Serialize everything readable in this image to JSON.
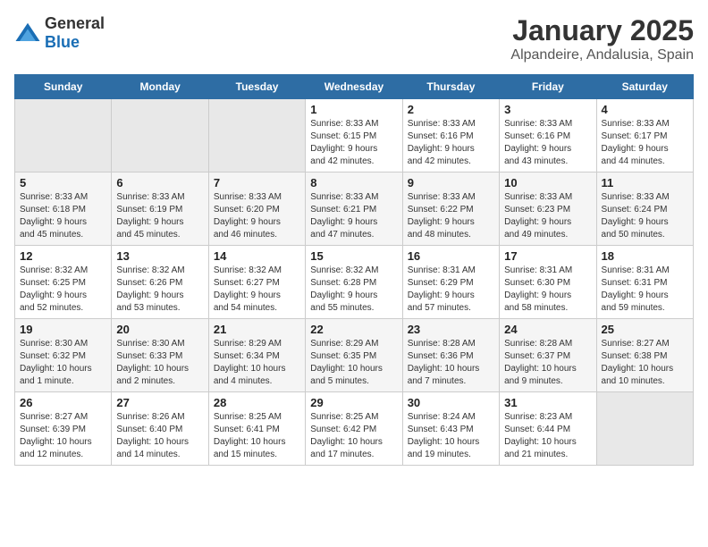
{
  "header": {
    "logo_general": "General",
    "logo_blue": "Blue",
    "title": "January 2025",
    "subtitle": "Alpandeire, Andalusia, Spain"
  },
  "weekdays": [
    "Sunday",
    "Monday",
    "Tuesday",
    "Wednesday",
    "Thursday",
    "Friday",
    "Saturday"
  ],
  "weeks": [
    [
      {
        "day": "",
        "info": ""
      },
      {
        "day": "",
        "info": ""
      },
      {
        "day": "",
        "info": ""
      },
      {
        "day": "1",
        "info": "Sunrise: 8:33 AM\nSunset: 6:15 PM\nDaylight: 9 hours\nand 42 minutes."
      },
      {
        "day": "2",
        "info": "Sunrise: 8:33 AM\nSunset: 6:16 PM\nDaylight: 9 hours\nand 42 minutes."
      },
      {
        "day": "3",
        "info": "Sunrise: 8:33 AM\nSunset: 6:16 PM\nDaylight: 9 hours\nand 43 minutes."
      },
      {
        "day": "4",
        "info": "Sunrise: 8:33 AM\nSunset: 6:17 PM\nDaylight: 9 hours\nand 44 minutes."
      }
    ],
    [
      {
        "day": "5",
        "info": "Sunrise: 8:33 AM\nSunset: 6:18 PM\nDaylight: 9 hours\nand 45 minutes."
      },
      {
        "day": "6",
        "info": "Sunrise: 8:33 AM\nSunset: 6:19 PM\nDaylight: 9 hours\nand 45 minutes."
      },
      {
        "day": "7",
        "info": "Sunrise: 8:33 AM\nSunset: 6:20 PM\nDaylight: 9 hours\nand 46 minutes."
      },
      {
        "day": "8",
        "info": "Sunrise: 8:33 AM\nSunset: 6:21 PM\nDaylight: 9 hours\nand 47 minutes."
      },
      {
        "day": "9",
        "info": "Sunrise: 8:33 AM\nSunset: 6:22 PM\nDaylight: 9 hours\nand 48 minutes."
      },
      {
        "day": "10",
        "info": "Sunrise: 8:33 AM\nSunset: 6:23 PM\nDaylight: 9 hours\nand 49 minutes."
      },
      {
        "day": "11",
        "info": "Sunrise: 8:33 AM\nSunset: 6:24 PM\nDaylight: 9 hours\nand 50 minutes."
      }
    ],
    [
      {
        "day": "12",
        "info": "Sunrise: 8:32 AM\nSunset: 6:25 PM\nDaylight: 9 hours\nand 52 minutes."
      },
      {
        "day": "13",
        "info": "Sunrise: 8:32 AM\nSunset: 6:26 PM\nDaylight: 9 hours\nand 53 minutes."
      },
      {
        "day": "14",
        "info": "Sunrise: 8:32 AM\nSunset: 6:27 PM\nDaylight: 9 hours\nand 54 minutes."
      },
      {
        "day": "15",
        "info": "Sunrise: 8:32 AM\nSunset: 6:28 PM\nDaylight: 9 hours\nand 55 minutes."
      },
      {
        "day": "16",
        "info": "Sunrise: 8:31 AM\nSunset: 6:29 PM\nDaylight: 9 hours\nand 57 minutes."
      },
      {
        "day": "17",
        "info": "Sunrise: 8:31 AM\nSunset: 6:30 PM\nDaylight: 9 hours\nand 58 minutes."
      },
      {
        "day": "18",
        "info": "Sunrise: 8:31 AM\nSunset: 6:31 PM\nDaylight: 9 hours\nand 59 minutes."
      }
    ],
    [
      {
        "day": "19",
        "info": "Sunrise: 8:30 AM\nSunset: 6:32 PM\nDaylight: 10 hours\nand 1 minute."
      },
      {
        "day": "20",
        "info": "Sunrise: 8:30 AM\nSunset: 6:33 PM\nDaylight: 10 hours\nand 2 minutes."
      },
      {
        "day": "21",
        "info": "Sunrise: 8:29 AM\nSunset: 6:34 PM\nDaylight: 10 hours\nand 4 minutes."
      },
      {
        "day": "22",
        "info": "Sunrise: 8:29 AM\nSunset: 6:35 PM\nDaylight: 10 hours\nand 5 minutes."
      },
      {
        "day": "23",
        "info": "Sunrise: 8:28 AM\nSunset: 6:36 PM\nDaylight: 10 hours\nand 7 minutes."
      },
      {
        "day": "24",
        "info": "Sunrise: 8:28 AM\nSunset: 6:37 PM\nDaylight: 10 hours\nand 9 minutes."
      },
      {
        "day": "25",
        "info": "Sunrise: 8:27 AM\nSunset: 6:38 PM\nDaylight: 10 hours\nand 10 minutes."
      }
    ],
    [
      {
        "day": "26",
        "info": "Sunrise: 8:27 AM\nSunset: 6:39 PM\nDaylight: 10 hours\nand 12 minutes."
      },
      {
        "day": "27",
        "info": "Sunrise: 8:26 AM\nSunset: 6:40 PM\nDaylight: 10 hours\nand 14 minutes."
      },
      {
        "day": "28",
        "info": "Sunrise: 8:25 AM\nSunset: 6:41 PM\nDaylight: 10 hours\nand 15 minutes."
      },
      {
        "day": "29",
        "info": "Sunrise: 8:25 AM\nSunset: 6:42 PM\nDaylight: 10 hours\nand 17 minutes."
      },
      {
        "day": "30",
        "info": "Sunrise: 8:24 AM\nSunset: 6:43 PM\nDaylight: 10 hours\nand 19 minutes."
      },
      {
        "day": "31",
        "info": "Sunrise: 8:23 AM\nSunset: 6:44 PM\nDaylight: 10 hours\nand 21 minutes."
      },
      {
        "day": "",
        "info": ""
      }
    ]
  ]
}
